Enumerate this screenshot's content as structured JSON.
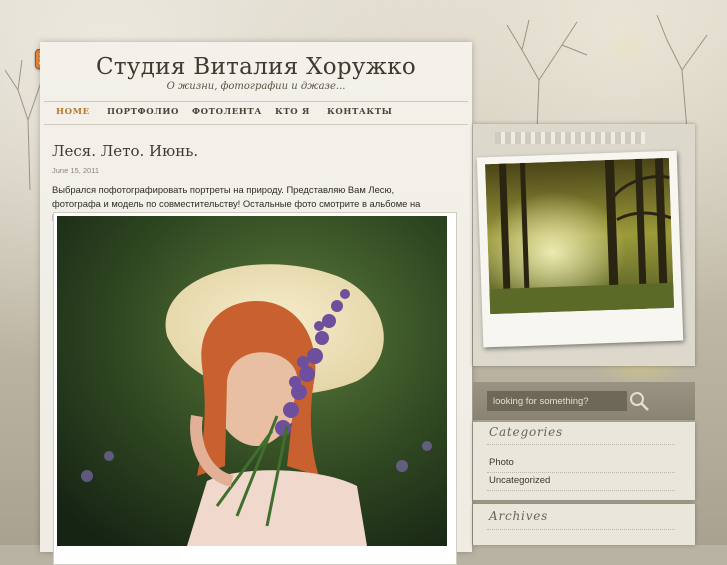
{
  "site": {
    "title": "Студия Виталия Хоружко",
    "tagline": "О жизни, фотографии и джазе..."
  },
  "nav": {
    "items": [
      {
        "label": "HOME",
        "active": true
      },
      {
        "label": "ПОРТФОЛИО",
        "active": false
      },
      {
        "label": "ФОТОЛЕНТА",
        "active": false
      },
      {
        "label": "КТО Я",
        "active": false
      },
      {
        "label": "КОНТАКТЫ",
        "active": false
      }
    ]
  },
  "post": {
    "title": "Леся. Лето. Июнь.",
    "date": "June 15, 2011",
    "text": "Выбрался пофотографировать портреты на природу. Представляю Вам Лесю, фотографа и модель по совместительству!  Остальные фото смотрите в альбоме на Flickr.com"
  },
  "search": {
    "placeholder": "looking for something?"
  },
  "sidebar": {
    "categories": {
      "title": "Categories",
      "items": [
        "Photo",
        "Uncategorized"
      ]
    },
    "archives": {
      "title": "Archives"
    }
  },
  "colors": {
    "accent": "#b5792b",
    "paper": "#f3f1ea",
    "text": "#3c3a33"
  },
  "icons": [
    "rss-icon",
    "search-icon"
  ]
}
